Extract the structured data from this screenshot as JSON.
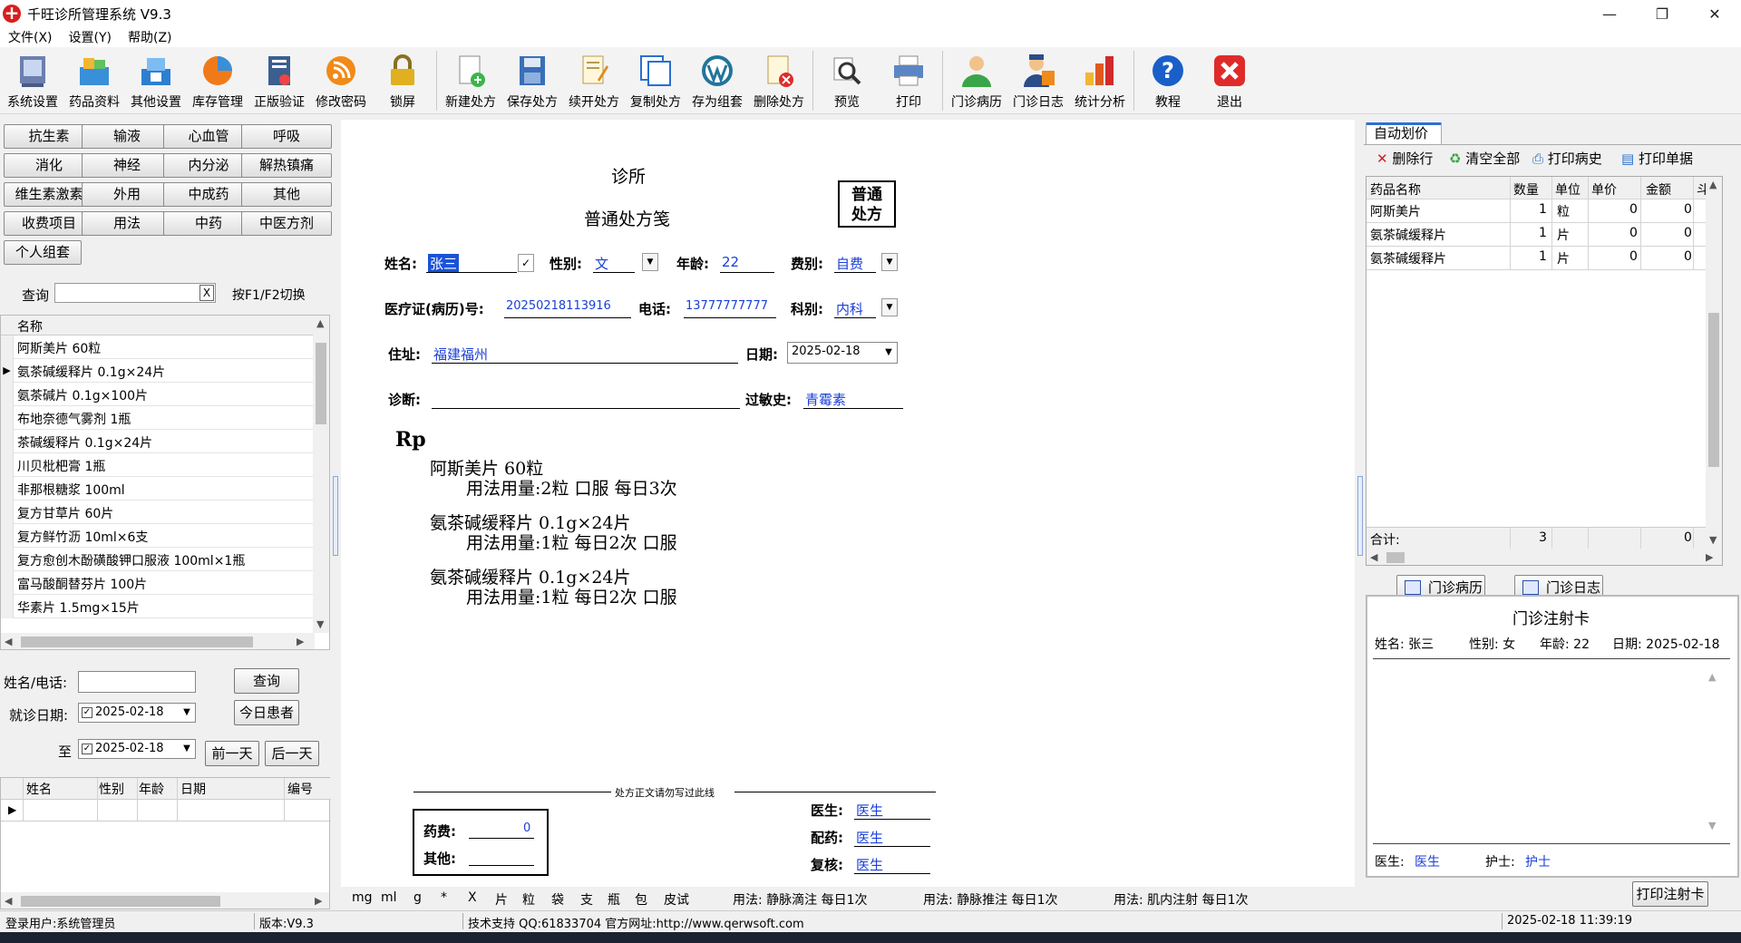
{
  "window": {
    "title": "千旺诊所管理系统 V9.3",
    "min": "—",
    "max": "❐",
    "close": "✕"
  },
  "menu": [
    "文件(X)",
    "设置(Y)",
    "帮助(Z)"
  ],
  "toolbar": {
    "sys_settings": "系统设置",
    "drug_info": "药品资料",
    "other_settings": "其他设置",
    "inventory": "库存管理",
    "verify": "正版验证",
    "change_pwd": "修改密码",
    "lock": "锁屏",
    "new_rx": "新建处方",
    "save_rx": "保存处方",
    "continue_rx": "续开处方",
    "copy_rx": "复制处方",
    "save_group": "存为组套",
    "delete_rx": "删除处方",
    "preview": "预览",
    "print": "打印",
    "case_history": "门诊病历",
    "clinic_log": "门诊日志",
    "stats": "统计分析",
    "tutorial": "教程",
    "exit": "退出"
  },
  "categories": [
    [
      "抗生素",
      "输液",
      "心血管",
      "呼吸"
    ],
    [
      "消化",
      "神经",
      "内分泌",
      "解热镇痛"
    ],
    [
      "维生素激素",
      "外用",
      "中成药",
      "其他"
    ],
    [
      "收费项目",
      "用法",
      "中药",
      "中医方剂"
    ],
    [
      "个人组套"
    ]
  ],
  "search": {
    "label": "查询",
    "value": "",
    "clear": "X",
    "hint": "按F1/F2切换"
  },
  "drug_list": {
    "header": "名称",
    "items": [
      "阿斯美片 60粒",
      "氨茶碱缓释片 0.1g×24片",
      "氨茶碱片 0.1g×100片",
      "布地奈德气雾剂 1瓶",
      "茶碱缓释片 0.1g×24片",
      "川贝枇杷膏 1瓶",
      "非那根糖浆 100ml",
      "复方甘草片 60片",
      "复方鲜竹沥 10ml×6支",
      "复方愈创木酚磺酸钾口服液 100ml×1瓶",
      "富马酸酮替芬片 100片",
      "华素片 1.5mg×15片"
    ]
  },
  "patient_search": {
    "name_label": "姓名/电话:",
    "name_value": "",
    "query_btn": "查询",
    "date_label": "就诊日期:",
    "date_from": "2025-02-18",
    "today_btn": "今日患者",
    "to_label": "至",
    "date_to": "2025-02-18",
    "prev_btn": "前一天",
    "next_btn": "后一天",
    "check": "✓"
  },
  "patient_grid": {
    "columns": [
      "姓名",
      "性别",
      "年龄",
      "日期",
      "编号"
    ]
  },
  "rx": {
    "clinic": "诊所",
    "form_title": "普通处方笺",
    "stamp": "普通\n处方",
    "name_label": "姓名:",
    "name": "张三",
    "gender_label": "性别:",
    "gender": "文",
    "age_label": "年龄:",
    "age": "22",
    "fee_label": "费别:",
    "fee_type": "自费",
    "card_label": "医疗证(病历)号:",
    "card_no": "20250218113916",
    "phone_label": "电话:",
    "phone": "13777777777",
    "dept_label": "科别:",
    "dept": "内科",
    "addr_label": "住址:",
    "address": "福建福州",
    "date_label": "日期:",
    "date": "2025-02-18",
    "diag_label": "诊断:",
    "diagnosis": "",
    "allergy_label": "过敏史:",
    "allergy": "青霉素",
    "rp": "Rp",
    "items": [
      {
        "name": "阿斯美片 60粒",
        "usage": "用法用量:2粒 口服 每日3次"
      },
      {
        "name": "氨茶碱缓释片 0.1g×24片",
        "usage": "用法用量:1粒 每日2次 口服"
      },
      {
        "name": "氨茶碱缓释片 0.1g×24片",
        "usage": "用法用量:1粒 每日2次 口服"
      }
    ],
    "divider_text": "处方正文请勿写过此线",
    "drug_fee_label": "药费:",
    "drug_fee": "0",
    "other_label": "其他:",
    "other": "",
    "doctor_label": "医生:",
    "doctor": "医生",
    "dispense_label": "配药:",
    "dispenser": "医生",
    "review_label": "复核:",
    "reviewer": "医生",
    "check": "✓"
  },
  "unit_bar": [
    "mg",
    "ml",
    "g",
    "*",
    "X",
    "片",
    "粒",
    "袋",
    "支",
    "瓶",
    "包",
    "皮试",
    "用法: 静脉滴注 每日1次",
    "用法: 静脉推注 每日1次",
    "用法: 肌内注射 每日1次"
  ],
  "right": {
    "tab": "自动划价",
    "delete_row": "删除行",
    "clear_all": "清空全部",
    "print_history": "打印病史",
    "print_receipt": "打印单据",
    "columns": [
      "药品名称",
      "数量",
      "单位",
      "单价",
      "金额",
      "斗位"
    ],
    "rows": [
      [
        "阿斯美片",
        "1",
        "粒",
        "0",
        "0"
      ],
      [
        "氨茶碱缓释片",
        "1",
        "片",
        "0",
        "0"
      ],
      [
        "氨茶碱缓释片",
        "1",
        "片",
        "0",
        "0"
      ]
    ],
    "total_label": "合计:",
    "total_qty": "3",
    "total_amount": "0",
    "case_btn": "门诊病历",
    "log_btn": "门诊日志",
    "inj_title": "门诊注射卡",
    "inj_name": "姓名: 张三",
    "inj_gender": "性别: 女",
    "inj_age": "年龄: 22",
    "inj_date": "日期: 2025-02-18",
    "inj_doctor_label": "医生:",
    "inj_doctor": "医生",
    "inj_nurse_label": "护士:",
    "inj_nurse": "护士",
    "print_inj": "打印注射卡"
  },
  "status": {
    "user": "登录用户:系统管理员",
    "version": "版本:V9.3",
    "support": "技术支持 QQ:61833704 官方网址:http://www.qerwsoft.com",
    "datetime": "2025-02-18 11:39:19"
  }
}
